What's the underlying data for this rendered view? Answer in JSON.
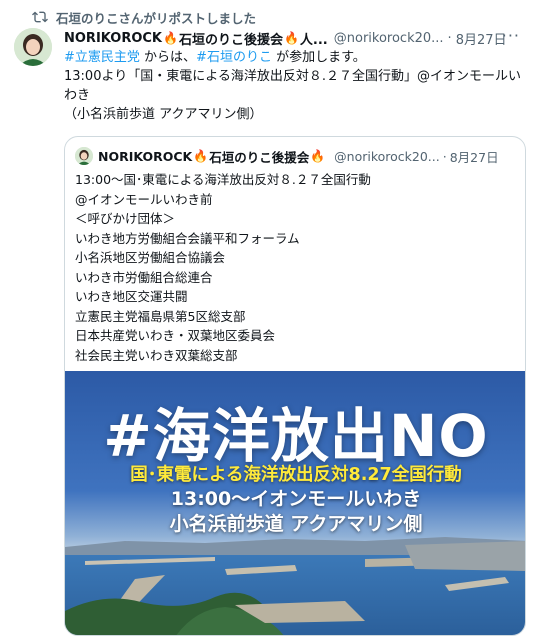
{
  "repost": {
    "label": "石垣のりこさんがリポストしました",
    "icon": "repost-icon"
  },
  "tweet": {
    "author_name": "NORIKOROCK",
    "author_name_2": "石垣のりこ後援会",
    "author_name_3": "人...",
    "handle": "@norikorock20...",
    "separator": "·",
    "date": "8月27日",
    "more_label": "···",
    "body": {
      "tag1": "#立憲民主党",
      "text1": " からは、",
      "tag2": "#石垣のりこ",
      "text2": " が参加します。",
      "line2": "13:00より「国・東電による海洋放出反対８.２７全国行動」@イオンモールいわき",
      "line3": "（小名浜前歩道 アクアマリン側）"
    }
  },
  "quote": {
    "author_name": "NORIKOROCK",
    "author_name_2": "石垣のりこ後援会",
    "handle": "@norikorock20...",
    "separator": "·",
    "date": "8月27日",
    "lines": [
      "13:00～国･東電による海洋放出反対８.２７全国行動",
      "@イオンモールいわき前",
      "＜呼びかけ団体＞",
      "いわき地方労働組合会議平和フォーラム",
      "小名浜地区労働組合協議会",
      "いわき市労働組合総連合",
      "いわき地区交運共闘",
      "立憲民主党福島県第5区総支部",
      "日本共産党いわき・双葉地区委員会",
      "社会民主党いわき双葉総支部"
    ],
    "image": {
      "title": "#海洋放出NO",
      "line1": "国･東電による海洋放出反対8.27全国行動",
      "line2": "13:00～イオンモールいわき",
      "line3": "小名浜前歩道 アクアマリン側"
    }
  },
  "colors": {
    "link": "#1d9bf0",
    "muted": "#536471",
    "banner_blue": "#2e5fa8",
    "banner_yellow": "#ffea3b",
    "flame": "#f28b00"
  }
}
